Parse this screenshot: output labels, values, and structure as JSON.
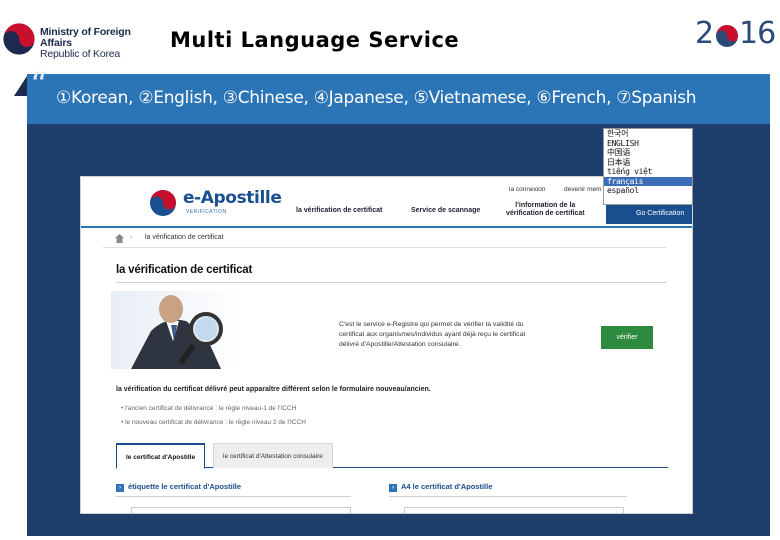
{
  "slide": {
    "logo_line1": "Ministry of Foreign Affairs",
    "logo_line2": "Republic of Korea",
    "title": "Multi Language Service",
    "year_part1": "2",
    "year_part2": "16",
    "banner_text": "①Korean, ②English, ③Chinese, ④Japanese, ⑤Vietnamese, ⑥French, ⑦Spanish"
  },
  "colors": {
    "banner_blue": "#2b74b6",
    "panel_navy": "#1e3e6b",
    "accent_red": "#c8102e",
    "brand_blue": "#1a4f8f",
    "verify_green": "#2d8a3e"
  },
  "language_menu": {
    "items": [
      "한국어",
      "ENGLISH",
      "中国语",
      "日本语",
      "tiếng việt",
      "français",
      "español"
    ],
    "selected_index": 5
  },
  "site": {
    "logo_title": "e-Apostille",
    "logo_subtitle": "VERIFICATION",
    "util_links": [
      "la connexion",
      "devenir mem"
    ],
    "nav": {
      "verification": "la vérification de certificat",
      "scan": "Service de scannage",
      "info_line1": "l'information de la",
      "info_line2": "vérification de certificat",
      "go": "Go Certification"
    },
    "breadcrumb_current": "la vérification de certificat",
    "page_heading": "la vérification de certificat",
    "description": "C'est le service e-Registre qui permet de vérifier la validité du certificat aux organismes/individus ayant déjà reçu le certificat délivré d'Apostille/Attestation consulaire.",
    "verify_button": "vérifier",
    "notice": "la vérification du certificat délivré peut apparaître différent selon le formulaire nouveau/ancien.",
    "bullets": [
      "• l'ancien certificat de délivrance : le règle niveau-1 de l'ICCH",
      "• le nouveau certificat de délivrance : le règle niveau 2 de l'ICCH"
    ],
    "tabs": [
      "le certificat d'Apostille",
      "le certificat d'Attestation consulaire"
    ],
    "sections": [
      "étiquette le certificat d'Apostille",
      "A4 le certificat d'Apostille"
    ]
  }
}
